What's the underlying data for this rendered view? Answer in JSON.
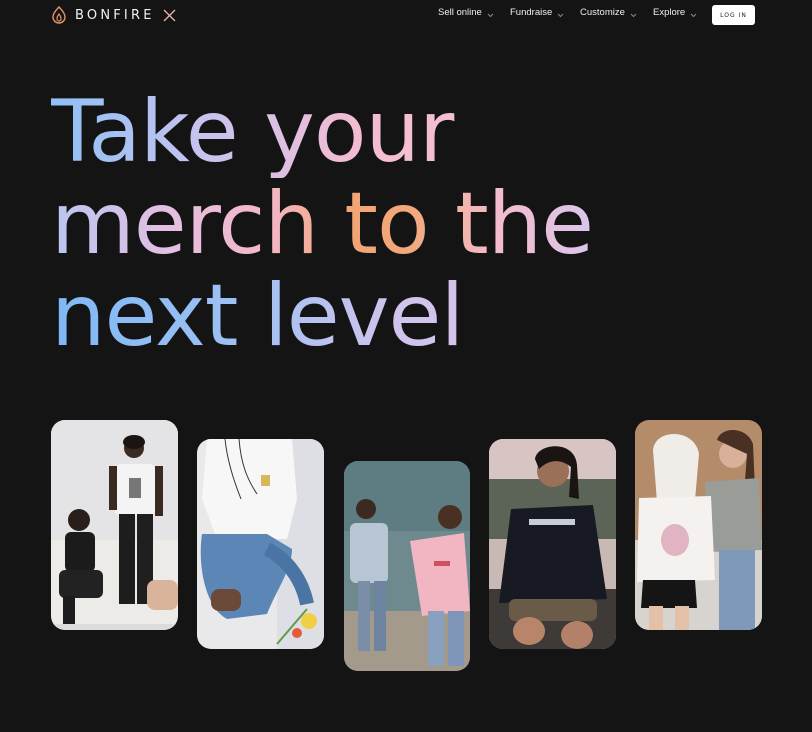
{
  "brand": {
    "name": "BONFIRE",
    "logo_icon": "flame-icon",
    "partner_icon": "x-icon",
    "accent": "#e8956b"
  },
  "nav": {
    "items": [
      {
        "label": "Sell online",
        "icon": "chevron-down-icon"
      },
      {
        "label": "Fundraise",
        "icon": "chevron-down-icon"
      },
      {
        "label": "Customize",
        "icon": "chevron-down-icon"
      },
      {
        "label": "Explore",
        "icon": "chevron-down-icon"
      }
    ],
    "login_label": "LOG IN"
  },
  "hero": {
    "lines": [
      "Take your",
      "merch to the",
      "next level"
    ]
  },
  "photos": [
    {
      "name": "photo-group-studio"
    },
    {
      "name": "photo-tee-closeup"
    },
    {
      "name": "photo-pink-sweatshirt-friends"
    },
    {
      "name": "photo-black-sweatshirt"
    },
    {
      "name": "photo-hoodie-friends"
    }
  ]
}
